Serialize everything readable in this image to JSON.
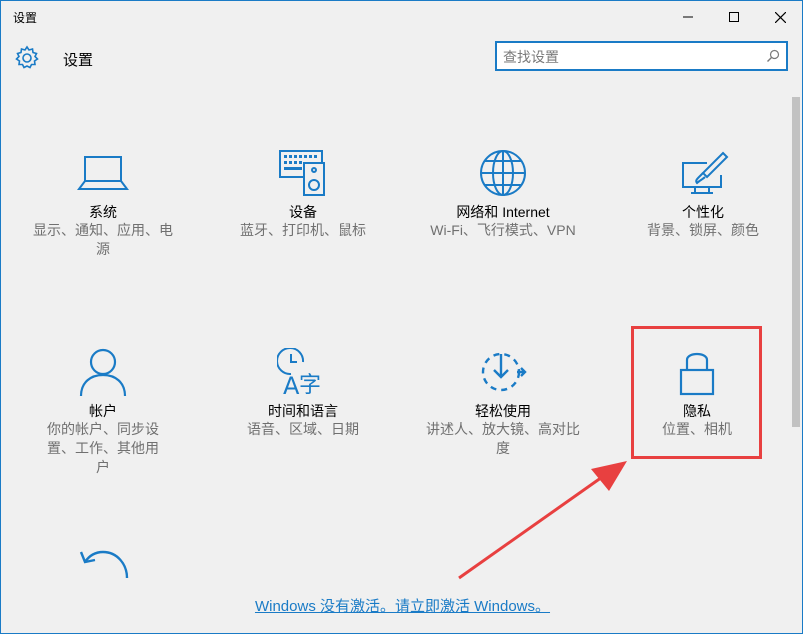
{
  "window": {
    "title": "设置"
  },
  "header": {
    "title": "设置"
  },
  "search": {
    "placeholder": "查找设置"
  },
  "tiles": [
    {
      "title": "系统",
      "desc": "显示、通知、应用、电源",
      "icon": "laptop-icon"
    },
    {
      "title": "设备",
      "desc": "蓝牙、打印机、鼠标",
      "icon": "devices-icon"
    },
    {
      "title": "网络和 Internet",
      "desc": "Wi-Fi、飞行模式、VPN",
      "icon": "globe-icon"
    },
    {
      "title": "个性化",
      "desc": "背景、锁屏、颜色",
      "icon": "personalization-icon"
    },
    {
      "title": "帐户",
      "desc": "你的帐户、同步设置、工作、其他用户",
      "icon": "person-icon"
    },
    {
      "title": "时间和语言",
      "desc": "语音、区域、日期",
      "icon": "time-language-icon"
    },
    {
      "title": "轻松使用",
      "desc": "讲述人、放大镜、高对比度",
      "icon": "ease-of-access-icon"
    },
    {
      "title": "隐私",
      "desc": "位置、相机",
      "icon": "lock-icon"
    }
  ],
  "footer": {
    "activate_link": "Windows 没有激活。请立即激活 Windows。"
  },
  "colors": {
    "accent": "#1a7bc6",
    "highlight": "#e84040"
  }
}
